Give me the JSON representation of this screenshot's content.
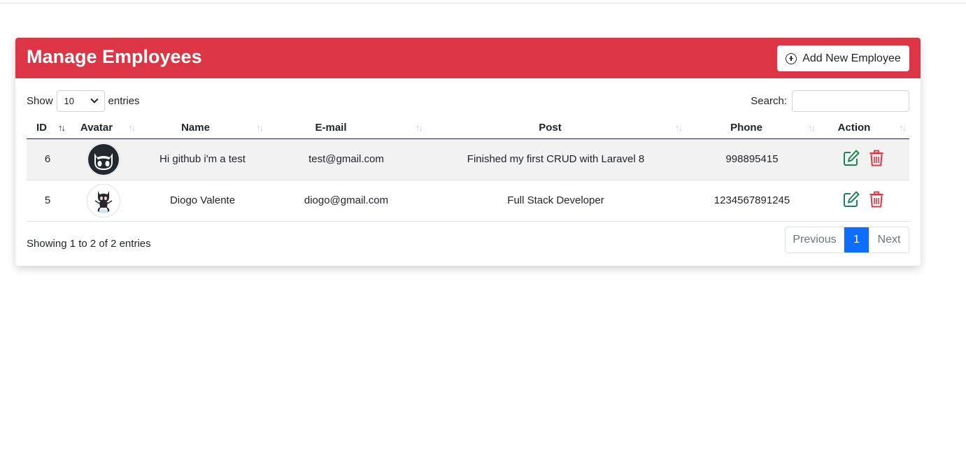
{
  "header": {
    "title": "Manage Employees",
    "add_button_label": "Add New Employee"
  },
  "controls": {
    "show_label": "Show",
    "entries_value": "10",
    "entries_label": "entries",
    "search_label": "Search:",
    "search_value": ""
  },
  "table": {
    "columns": [
      "ID",
      "Avatar",
      "Name",
      "E-mail",
      "Post",
      "Phone",
      "Action"
    ],
    "sorted_column": "ID",
    "rows": [
      {
        "id": "6",
        "avatar": "github-octocat-face-icon",
        "name": "Hi github i'm a test",
        "email": "test@gmail.com",
        "post": "Finished my first CRUD with Laravel 8",
        "phone": "998895415"
      },
      {
        "id": "5",
        "avatar": "github-octocat-icon",
        "name": "Diogo Valente",
        "email": "diogo@gmail.com",
        "post": "Full Stack Developer",
        "phone": "1234567891245"
      }
    ]
  },
  "footer": {
    "info": "Showing 1 to 2 of 2 entries",
    "previous_label": "Previous",
    "current_page": "1",
    "next_label": "Next"
  },
  "colors": {
    "header_bg": "#dc3545",
    "edit_icon": "#198754",
    "delete_icon": "#dc3545",
    "active_page": "#0d6efd"
  }
}
